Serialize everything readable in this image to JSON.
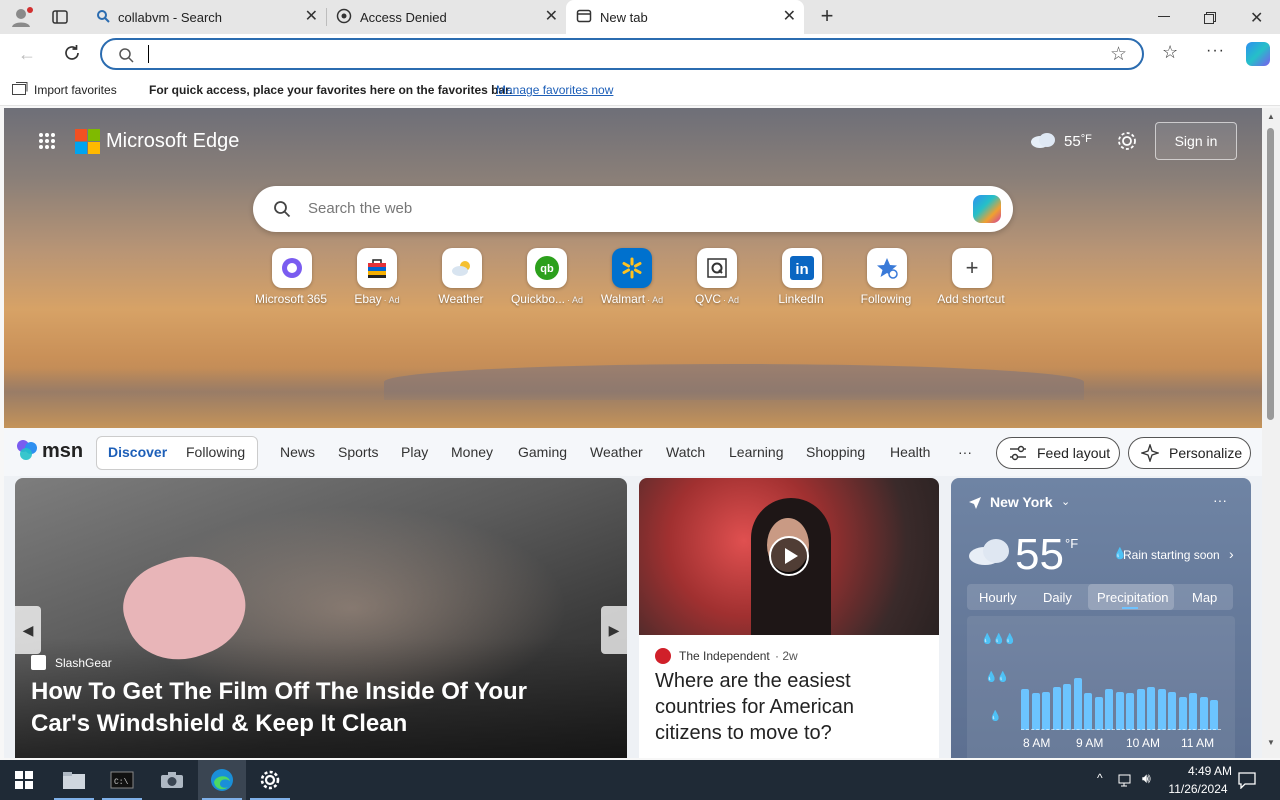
{
  "tabs": [
    {
      "title": "collabvm - Search",
      "icon": "search-icon"
    },
    {
      "title": "Access Denied",
      "icon": "shield-icon"
    },
    {
      "title": "New tab",
      "icon": "new-tab-icon"
    }
  ],
  "toolbar": {
    "address_value": ""
  },
  "favorites_bar": {
    "import_label": "Import favorites",
    "message": "For quick access, place your favorites here on the favorites bar.",
    "manage_link": "Manage favorites now"
  },
  "header": {
    "brand": "Microsoft Edge",
    "temperature": "55",
    "temp_unit": "°F",
    "sign_in": "Sign in"
  },
  "search": {
    "placeholder": "Search the web"
  },
  "shortcuts": [
    {
      "label": "Microsoft 365",
      "ad": ""
    },
    {
      "label": "Ebay",
      "ad": "· Ad"
    },
    {
      "label": "Weather",
      "ad": ""
    },
    {
      "label": "Quickbo...",
      "ad": "· Ad"
    },
    {
      "label": "Walmart",
      "ad": "· Ad"
    },
    {
      "label": "QVC",
      "ad": "· Ad"
    },
    {
      "label": "LinkedIn",
      "ad": ""
    },
    {
      "label": "Following",
      "ad": ""
    },
    {
      "label": "Add shortcut",
      "ad": ""
    }
  ],
  "msn": {
    "logo": "msn",
    "tabs": [
      "Discover",
      "Following"
    ],
    "nav": [
      "News",
      "Sports",
      "Play",
      "Money",
      "Gaming",
      "Weather",
      "Watch",
      "Learning",
      "Shopping",
      "Health"
    ],
    "more": "···",
    "feed_layout": "Feed layout",
    "personalize": "Personalize"
  },
  "main_card": {
    "source": "SlashGear",
    "headline": "How To Get The Film Off The Inside Of Your Car's Windshield & Keep It Clean"
  },
  "news_card": {
    "source": "The Independent",
    "age": "· 2w",
    "headline": "Where are the easiest countries for American citizens to move to?"
  },
  "weather_card": {
    "location": "New York",
    "temp": "55",
    "unit": "°F",
    "alert": "Rain starting soon",
    "tabs": [
      "Hourly",
      "Daily",
      "Precipitation",
      "Map"
    ],
    "times": [
      "8 AM",
      "9 AM",
      "10 AM",
      "11 AM"
    ],
    "bars": [
      0.55,
      0.5,
      0.52,
      0.58,
      0.62,
      0.7,
      0.5,
      0.45,
      0.55,
      0.52,
      0.5,
      0.55,
      0.58,
      0.55,
      0.52,
      0.45,
      0.5,
      0.45,
      0.4
    ]
  },
  "taskbar": {
    "time": "4:49 AM",
    "date": "11/26/2024"
  }
}
